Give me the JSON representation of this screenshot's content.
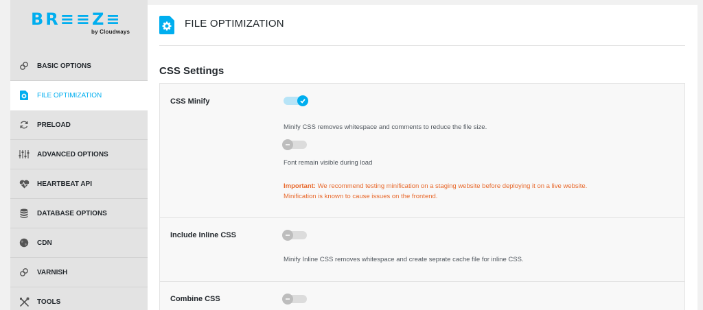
{
  "brand": {
    "name": "BR≡≡Z≡",
    "sub": "by Cloudways",
    "color": "#00aeef"
  },
  "sidebar": {
    "items": [
      {
        "label": "BASIC OPTIONS",
        "icon": "link-icon",
        "active": false
      },
      {
        "label": "FILE OPTIMIZATION",
        "icon": "file-gear-icon",
        "active": true
      },
      {
        "label": "PRELOAD",
        "icon": "refresh-icon",
        "active": false
      },
      {
        "label": "ADVANCED OPTIONS",
        "icon": "sliders-icon",
        "active": false
      },
      {
        "label": "HEARTBEAT API",
        "icon": "heartbeat-icon",
        "active": false
      },
      {
        "label": "DATABASE OPTIONS",
        "icon": "database-icon",
        "active": false
      },
      {
        "label": "CDN",
        "icon": "globe-icon",
        "active": false
      },
      {
        "label": "VARNISH",
        "icon": "link-icon",
        "active": false
      },
      {
        "label": "TOOLS",
        "icon": "tools-icon",
        "active": false
      }
    ]
  },
  "header": {
    "title": "FILE OPTIMIZATION",
    "icon": "file-gear-icon"
  },
  "section": {
    "title": "CSS Settings"
  },
  "settings": {
    "css_minify": {
      "label": "CSS Minify",
      "enabled": true,
      "description": "Minify CSS removes whitespace and comments to reduce the file size.",
      "font_toggle_enabled": false,
      "font_description": "Font remain visible during load",
      "warning_strong": "Important:",
      "warning_line1": " We recommend testing minification on a staging website before deploying it on a live website.",
      "warning_line2": "Minification is known to cause issues on the frontend."
    },
    "inline_css": {
      "label": "Include Inline CSS",
      "enabled": false,
      "description": "Minify Inline CSS removes whitespace and create seprate cache file for inline CSS."
    },
    "combine_css": {
      "label": "Combine CSS",
      "enabled": false
    }
  },
  "colors": {
    "accent": "#00aeef",
    "warning": "#e8692c"
  }
}
